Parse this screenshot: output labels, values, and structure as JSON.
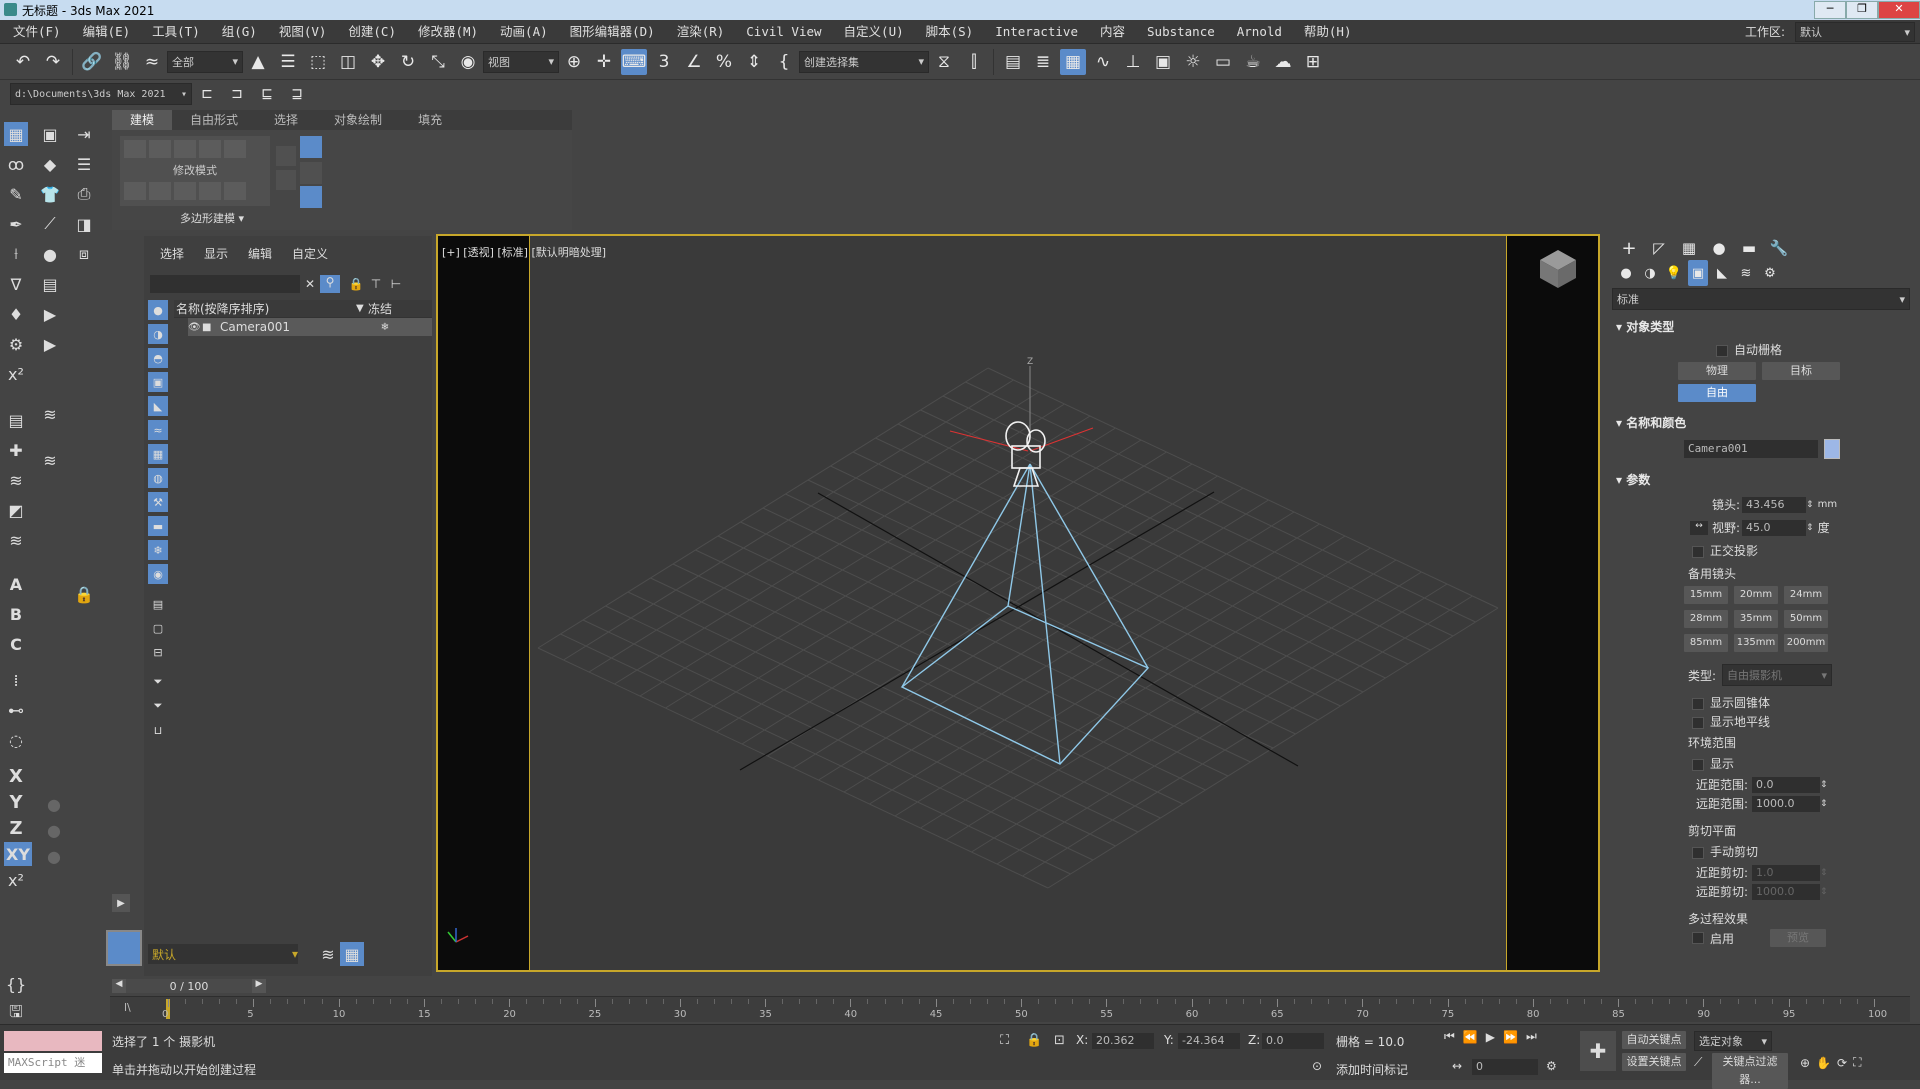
{
  "window": {
    "title": "无标题 - 3ds Max 2021",
    "min": "─",
    "max": "❐",
    "close": "✕"
  },
  "menu": [
    "文件(F)",
    "编辑(E)",
    "工具(T)",
    "组(G)",
    "视图(V)",
    "创建(C)",
    "修改器(M)",
    "动画(A)",
    "图形编辑器(D)",
    "渲染(R)",
    "Civil View",
    "自定义(U)",
    "脚本(S)",
    "Interactive",
    "内容",
    "Substance",
    "Arnold",
    "帮助(H)"
  ],
  "workspace": {
    "label": "工作区:",
    "value": "默认"
  },
  "toolbar": {
    "selection_filter": "全部",
    "ref_coord": "视图",
    "named_selection": "创建选择集"
  },
  "project_path": "d:\\Documents\\3ds Max 2021",
  "ribbon": {
    "tabs": [
      "建模",
      "自由形式",
      "选择",
      "对象绘制",
      "填充"
    ],
    "active_tab": "建模",
    "panel_label": "修改模式",
    "footer_label": "多边形建模"
  },
  "explorer": {
    "tabs": [
      "选择",
      "显示",
      "编辑",
      "自定义"
    ],
    "col_name": "名称(按降序排序)",
    "col_freeze": "冻结",
    "rows": [
      {
        "name": "Camera001"
      }
    ],
    "layer": "默认"
  },
  "viewport": {
    "label": "[+] [透视] [标准] [默认明暗处理]",
    "axis_z": "Z",
    "grid_x": "X",
    "grid_y": "Y"
  },
  "command_panel": {
    "category_dropdown": "标准",
    "object_type": {
      "title": "对象类型",
      "auto_grid": "自动栅格",
      "buttons": [
        "物理",
        "目标",
        "自由"
      ],
      "active": "自由"
    },
    "name_color": {
      "title": "名称和颜色",
      "name": "Camera001",
      "color": "#9db7e6"
    },
    "params": {
      "title": "参数",
      "lens_label": "镜头:",
      "lens_value": "43.456",
      "lens_unit": "mm",
      "fov_label": "视野:",
      "fov_value": "45.0",
      "fov_unit": "度",
      "ortho": "正交投影",
      "stock_title": "备用镜头",
      "stock_lenses": [
        "15mm",
        "20mm",
        "24mm",
        "28mm",
        "35mm",
        "50mm",
        "85mm",
        "135mm",
        "200mm"
      ],
      "type_label": "类型:",
      "type_value": "自由摄影机",
      "show_cone": "显示圆锥体",
      "show_horizon": "显示地平线",
      "env_title": "环境范围",
      "env_show": "显示",
      "near_range_label": "近距范围:",
      "near_range": "0.0",
      "far_range_label": "远距范围:",
      "far_range": "1000.0",
      "clip_title": "剪切平面",
      "manual_clip": "手动剪切",
      "near_clip_label": "近距剪切:",
      "near_clip": "1.0",
      "far_clip_label": "远距剪切:",
      "far_clip": "1000.0",
      "multipass_title": "多过程效果",
      "enable": "启用",
      "preview": "预览"
    }
  },
  "timeline": {
    "frame_display": "0 / 100",
    "ticks": [
      "0",
      "5",
      "10",
      "15",
      "20",
      "25",
      "30",
      "35",
      "40",
      "45",
      "50",
      "55",
      "60",
      "65",
      "70",
      "75",
      "80",
      "85",
      "90",
      "95",
      "100"
    ]
  },
  "status": {
    "maxscript": "MAXScript 迷",
    "selected": "选择了 1 个 摄影机",
    "prompt": "单击并拖动以开始创建过程",
    "x_label": "X:",
    "x_value": "20.362",
    "y_label": "Y:",
    "y_value": "-24.364",
    "z_label": "Z:",
    "z_value": "0.0",
    "grid": "栅格 = 10.0",
    "add_time_tag": "添加时间标记",
    "auto_key": "自动关键点",
    "set_key": "设置关键点",
    "selected_obj": "选定对象",
    "key_filters": "关键点过滤器...",
    "frame_field": "0"
  }
}
